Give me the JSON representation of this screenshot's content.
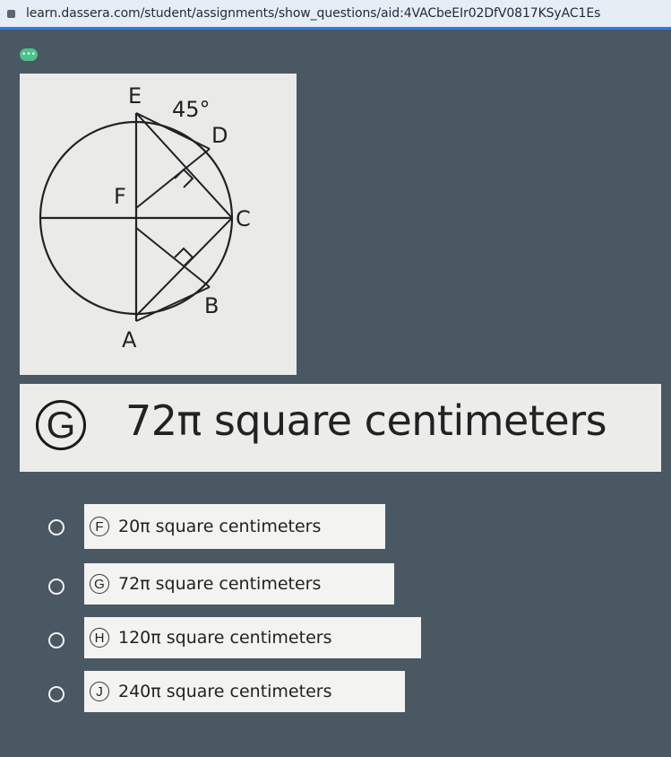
{
  "browser": {
    "url": "learn.dassera.com/student/assignments/show_questions/aid:4VACbeEIr02DfV0817KSyAC1Es"
  },
  "question": {
    "help_icon": "dots-icon",
    "figure": {
      "labels": {
        "E": "E",
        "angle": "45°",
        "D": "D",
        "F": "F",
        "C": "C",
        "B": "B",
        "A": "A"
      }
    }
  },
  "selected_answer": {
    "letter": "G",
    "text": "72π square centimeters"
  },
  "options": [
    {
      "letter": "F",
      "text": "20π square centimeters"
    },
    {
      "letter": "G",
      "text": "72π square centimeters"
    },
    {
      "letter": "H",
      "text": "120π square centimeters"
    },
    {
      "letter": "J",
      "text": "240π square centimeters"
    }
  ],
  "colors": {
    "background": "#4a5864",
    "url_bar": "#e6edf5",
    "url_underline": "#2e7be2",
    "panel": "#ececea",
    "help_dot": "#4fbf8c"
  }
}
